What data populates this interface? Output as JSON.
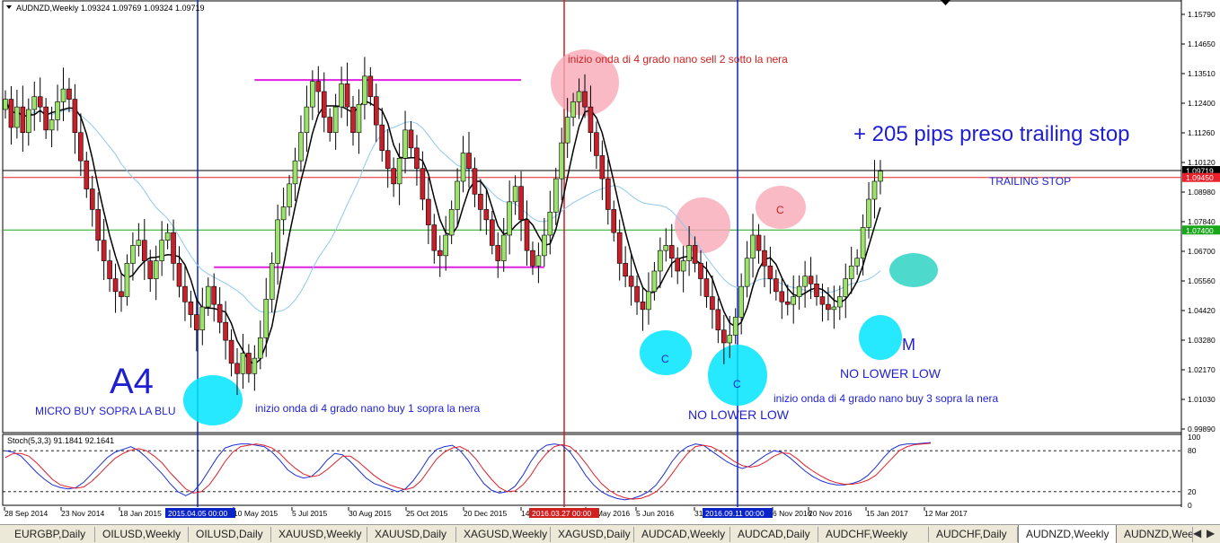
{
  "window": {
    "header": "AUDNZD,Weekly  1.09324 1.09769 1.09324 1.09719",
    "price_tags": [
      "1.15790",
      "1.14650",
      "1.13510",
      "1.12400",
      "1.11260",
      "1.10120",
      "1.08980",
      "1.07840",
      "1.06700",
      "1.05560",
      "1.04420",
      "1.03280",
      "1.02170",
      "1.01030",
      "0.99890"
    ],
    "price_markers": [
      {
        "label": "1.09719",
        "color": "#000000"
      },
      {
        "label": "1.09450",
        "color": "#e8212a"
      },
      {
        "label": "1.07400",
        "color": "#1aa61a"
      }
    ],
    "date_ticks": [
      "28 Sep 2014",
      "23 Nov 2014",
      "18 Jan 2015",
      "10 May 2015",
      "5 Jul 2015",
      "30 Aug 2015",
      "25 Oct 2015",
      "20 Dec 2015",
      "14",
      "22 May 2016",
      "5 Jun 2016",
      "31",
      "6 Nov 2016",
      "20 Nov 2016",
      "15 Jan 2017",
      "12 Mar 2017"
    ],
    "date_highlights": [
      {
        "label": "2015.04.05 00:00",
        "color": "#0a24c8"
      },
      {
        "label": "2016.03.27 00:00",
        "color": "#d01f1f"
      },
      {
        "label": "2016.09.11 00:00",
        "color": "#0a24c8"
      }
    ]
  },
  "annotations": {
    "a4": "A4",
    "micro_buy": "MICRO BUY SOPRA LA BLU",
    "wave_buy_1": "inizio onda di 4 grado nano buy 1 sopra la nera",
    "wave_sell_2": "inizio onda di 4 grado nano sell 2 sotto la nera",
    "pips": "+ 205 pips preso trailing stop",
    "trailing_stop": "TRAILING STOP",
    "no_lower_low_1": "NO LOWER LOW",
    "no_lower_low_2": "NO LOWER LOW",
    "wave_buy_3": "inizio onda di 4 grado nano buy 3 sopra la nera",
    "m_label": "M",
    "c_labels": [
      "C",
      "C",
      "C"
    ]
  },
  "oscillator": {
    "label": "Stoch(5,3,3) 91.1841 92.1641",
    "levels": [
      "100",
      "80",
      "20",
      "0"
    ]
  },
  "tabs": [
    {
      "label": "EURGBP,Daily",
      "active": false
    },
    {
      "label": "OILUSD,Weekly",
      "active": false
    },
    {
      "label": "OILUSD,Daily",
      "active": false
    },
    {
      "label": "XAUUSD,Weekly",
      "active": false
    },
    {
      "label": "XAUUSD,Daily",
      "active": false
    },
    {
      "label": "XAGUSD,Weekly",
      "active": false
    },
    {
      "label": "XAGUSD,Daily",
      "active": false
    },
    {
      "label": "AUDCAD,Weekly",
      "active": false
    },
    {
      "label": "AUDCAD,Daily",
      "active": false
    },
    {
      "label": "AUDCHF,Weekly",
      "active": false
    },
    {
      "label": "AUDCHF,Daily",
      "active": false
    },
    {
      "label": "AUDNZD,Weekly",
      "active": true
    },
    {
      "label": "AUDNZD,Wee",
      "active": false
    }
  ],
  "chart_data": {
    "type": "candlestick",
    "symbol": "AUDNZD",
    "timeframe": "Weekly",
    "ohlc_current": {
      "open": 1.09324,
      "high": 1.09769,
      "low": 1.09324,
      "close": 1.09719
    },
    "ylim": [
      0.995,
      1.163
    ],
    "horizontal_lines": [
      {
        "value": 1.09719,
        "color": "#000000"
      },
      {
        "value": 1.0945,
        "color": "#e8212a"
      },
      {
        "value": 1.074,
        "color": "#1aa61a"
      },
      {
        "value": 1.1325,
        "color": "#e020e0",
        "from_week": 43,
        "to_week": 89
      },
      {
        "value": 1.0595,
        "color": "#e020e0",
        "from_week": 36,
        "to_week": 93
      }
    ],
    "vertical_markers": [
      "2015.04.05 00:00",
      "2016.03.27 00:00",
      "2016.09.11 00:00"
    ],
    "closes": [
      1.125,
      1.114,
      1.122,
      1.112,
      1.121,
      1.126,
      1.122,
      1.113,
      1.117,
      1.124,
      1.129,
      1.125,
      1.112,
      1.101,
      1.09,
      1.082,
      1.07,
      1.062,
      1.055,
      1.05,
      1.048,
      1.061,
      1.068,
      1.07,
      1.062,
      1.055,
      1.062,
      1.07,
      1.073,
      1.061,
      1.052,
      1.046,
      1.041,
      1.035,
      1.044,
      1.052,
      1.045,
      1.038,
      1.031,
      1.022,
      1.018,
      1.026,
      1.018,
      1.024,
      1.032,
      1.047,
      1.061,
      1.078,
      1.083,
      1.092,
      1.101,
      1.112,
      1.122,
      1.132,
      1.128,
      1.118,
      1.112,
      1.122,
      1.131,
      1.122,
      1.112,
      1.123,
      1.134,
      1.126,
      1.115,
      1.105,
      1.098,
      1.092,
      1.102,
      1.113,
      1.106,
      1.098,
      1.086,
      1.076,
      1.066,
      1.064,
      1.072,
      1.082,
      1.093,
      1.104,
      1.098,
      1.088,
      1.082,
      1.078,
      1.068,
      1.062,
      1.072,
      1.085,
      1.091,
      1.078,
      1.066,
      1.06,
      1.064,
      1.072,
      1.081,
      1.094,
      1.108,
      1.118,
      1.124,
      1.128,
      1.122,
      1.112,
      1.103,
      1.094,
      1.082,
      1.073,
      1.061,
      1.056,
      1.052,
      1.046,
      1.043,
      1.05,
      1.058,
      1.066,
      1.068,
      1.063,
      1.058,
      1.062,
      1.068,
      1.061,
      1.055,
      1.048,
      1.043,
      1.035,
      1.03,
      1.033,
      1.04,
      1.052,
      1.063,
      1.072,
      1.066,
      1.06,
      1.055,
      1.05,
      1.046,
      1.045,
      1.048,
      1.052,
      1.056,
      1.053,
      1.048,
      1.045,
      1.043,
      1.044,
      1.048,
      1.055,
      1.06,
      1.063,
      1.075,
      1.086,
      1.093,
      1.097
    ],
    "stoch_k": [
      80,
      78,
      72,
      60,
      48,
      38,
      30,
      26,
      24,
      26,
      34,
      46,
      58,
      70,
      78,
      82,
      86,
      80,
      70,
      58,
      46,
      32,
      20,
      14,
      20,
      34,
      52,
      70,
      84,
      88,
      90,
      90,
      88,
      86,
      78,
      66,
      52,
      44,
      40,
      42,
      52,
      66,
      76,
      74,
      64,
      52,
      40,
      32,
      28,
      24,
      20,
      24,
      36,
      52,
      70,
      82,
      86,
      88,
      80,
      66,
      48,
      32,
      22,
      18,
      20,
      28,
      44,
      64,
      80,
      88,
      90,
      88,
      78,
      62,
      44,
      30,
      20,
      14,
      10,
      8,
      10,
      14,
      20,
      30,
      46,
      64,
      78,
      86,
      90,
      88,
      80,
      72,
      64,
      58,
      54,
      58,
      66,
      74,
      80,
      78,
      70,
      60,
      50,
      42,
      36,
      32,
      30,
      30,
      32,
      36,
      44,
      56,
      70,
      82,
      88,
      90,
      90,
      91,
      92
    ],
    "stoch_d": [
      70,
      76,
      76,
      72,
      62,
      50,
      38,
      30,
      27,
      25,
      27,
      35,
      46,
      58,
      69,
      76,
      81,
      83,
      80,
      72,
      62,
      48,
      36,
      24,
      18,
      20,
      30,
      46,
      64,
      78,
      86,
      88,
      90,
      88,
      84,
      76,
      64,
      54,
      46,
      42,
      44,
      52,
      62,
      72,
      72,
      64,
      54,
      44,
      36,
      30,
      26,
      23,
      26,
      36,
      52,
      68,
      78,
      84,
      86,
      80,
      68,
      52,
      38,
      26,
      20,
      21,
      30,
      44,
      62,
      76,
      86,
      89,
      86,
      76,
      62,
      46,
      32,
      22,
      15,
      11,
      9,
      10,
      14,
      20,
      31,
      46,
      62,
      76,
      86,
      88,
      86,
      80,
      72,
      64,
      58,
      56,
      58,
      64,
      72,
      77,
      76,
      68,
      58,
      50,
      43,
      37,
      33,
      31,
      31,
      33,
      37,
      44,
      56,
      68,
      80,
      86,
      89,
      90,
      91
    ]
  }
}
